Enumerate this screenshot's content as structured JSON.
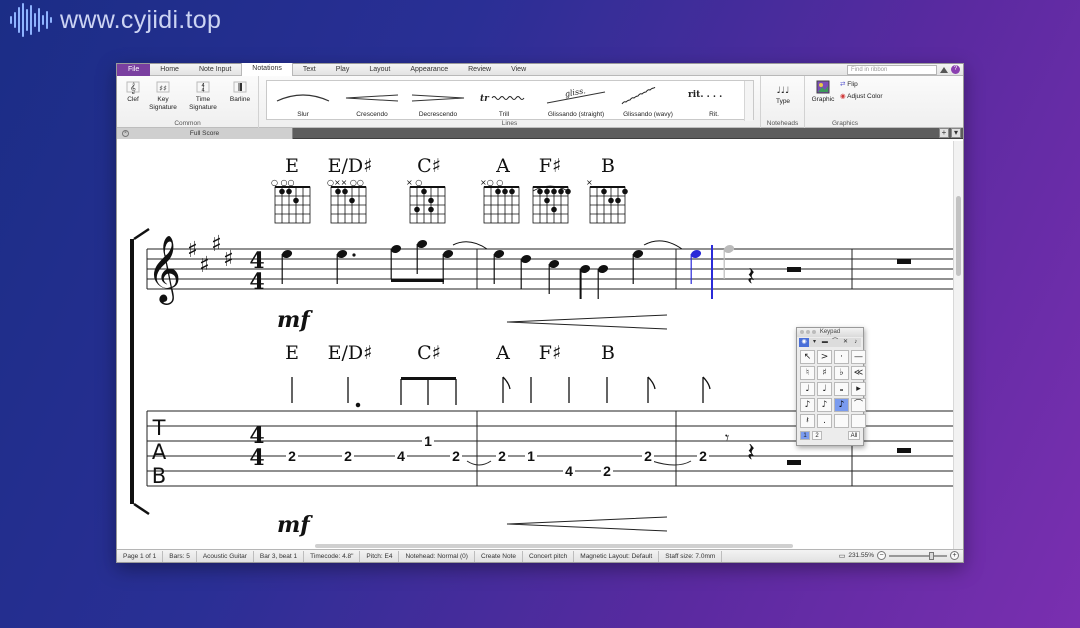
{
  "watermark": {
    "text": "www.cyjidi.top"
  },
  "ribbon": {
    "tabs": [
      "File",
      "Home",
      "Note Input",
      "Notations",
      "Text",
      "Play",
      "Layout",
      "Appearance",
      "Review",
      "View"
    ],
    "active_tab": "Notations",
    "search_placeholder": "Find in ribbon",
    "common": {
      "label": "Common",
      "clef": "Clef",
      "key_signature": "Key Signature",
      "time_signature": "Time Signature",
      "barline": "Barline"
    },
    "lines": {
      "label": "Lines",
      "items": [
        "Slur",
        "Crescendo",
        "Decrescendo",
        "Trill",
        "Glissando (straight)",
        "Glissando (wavy)",
        "Rit."
      ],
      "trill_glyph": "tr",
      "gliss_glyph": "gliss.",
      "rit_glyph": "rit. . . ."
    },
    "noteheads": {
      "label": "Noteheads",
      "type": "Type"
    },
    "graphics": {
      "label": "Graphics",
      "graphic": "Graphic",
      "flip": "Flip",
      "adjust_color": "Adjust Color"
    }
  },
  "document": {
    "tab_title": "Full Score"
  },
  "score": {
    "chords_top": [
      "E",
      "E/D♯",
      "C♯",
      "A",
      "F♯",
      "B"
    ],
    "chords_bottom": [
      "E",
      "E/D♯",
      "C♯",
      "A",
      "F♯",
      "B"
    ],
    "dynamic_top": "mf",
    "dynamic_bottom": "mf",
    "time_signature_top": "4",
    "time_signature_bottom": "4",
    "tab_letters": [
      "T",
      "A",
      "B"
    ],
    "tab_numbers": [
      {
        "text": "2"
      },
      {
        "text": "2"
      },
      {
        "text": "4"
      },
      {
        "text": "1"
      },
      {
        "text": "2"
      },
      {
        "text": "2"
      },
      {
        "text": "1"
      },
      {
        "text": "4"
      },
      {
        "text": "2"
      },
      {
        "text": "2"
      },
      {
        "text": "2"
      }
    ],
    "chord_diagram_markers": [
      "○    ○○",
      "○××   ○○",
      "×      ○",
      "×○    ○",
      "",
      "×"
    ]
  },
  "keypad": {
    "title": "Keypad",
    "tabs": [
      "1",
      "2",
      "All"
    ],
    "keys": [
      "↖",
      ">",
      "·",
      "—",
      "♮",
      "♯",
      "♭",
      "≪",
      "♩",
      "♩",
      "𝅝",
      "▸",
      "♪",
      "♪",
      "♪",
      "⌒",
      "𝄽",
      ".",
      "",
      ""
    ]
  },
  "status_bar": {
    "page": "Page 1 of 1",
    "bars": "Bars: 5",
    "instrument": "Acoustic Guitar",
    "position": "Bar 3, beat 1",
    "timecode": "Timecode: 4.8\"",
    "pitch": "Pitch: E4",
    "notehead": "Notehead: Normal (0)",
    "mode": "Create Note",
    "concert_pitch": "Concert pitch",
    "magnetic_layout": "Magnetic Layout: Default",
    "staff_size": "Staff size: 7.0mm",
    "zoom": "231.55%"
  }
}
